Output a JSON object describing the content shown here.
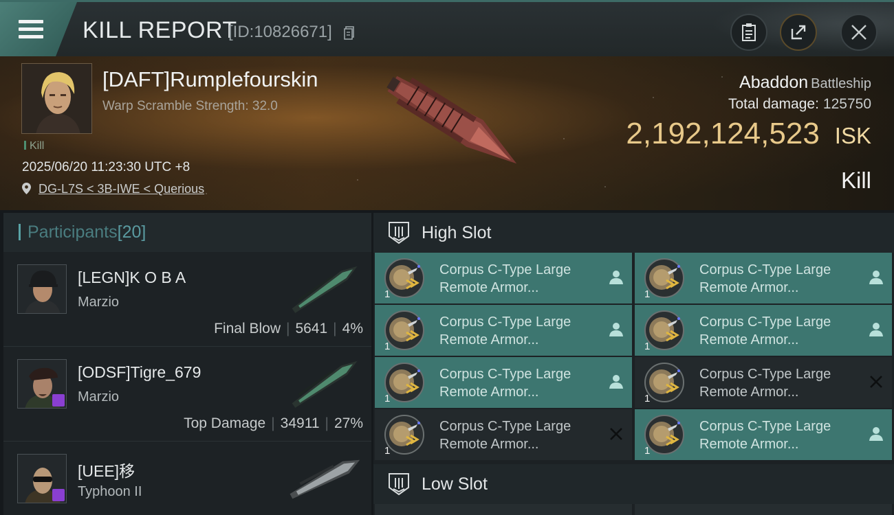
{
  "header": {
    "title": "KILL REPORT",
    "report_id": "[ID:10826671]"
  },
  "victim": {
    "name": "[DAFT]Rumplefourskin",
    "warp_scramble": "Warp Scramble Strength: 32.0",
    "tag": "Kill",
    "datetime": "2025/06/20 11:23:30 UTC +8",
    "location": "DG-L7S < 3B-IWE < Querious",
    "ship_name": "Abaddon",
    "ship_class": "Battleship",
    "total_damage_label": "Total damage:",
    "total_damage": "125750",
    "isk_value": "2,192,124,523",
    "isk_unit": "ISK",
    "result": "Kill"
  },
  "participants": {
    "title": "Participants",
    "count": "[20]",
    "rows": [
      {
        "name": "[LEGN]K O B A",
        "ship": "Marzio",
        "role": "Final Blow",
        "damage": "5641",
        "percent": "4%"
      },
      {
        "name": "[ODSF]Tigre_679",
        "ship": "Marzio",
        "role": "Top Damage",
        "damage": "34911",
        "percent": "27%"
      },
      {
        "name": "[UEE]移",
        "ship": "Typhoon II",
        "role": "",
        "damage": "",
        "percent": ""
      }
    ]
  },
  "slots": {
    "high_label": "High Slot",
    "low_label": "Low Slot",
    "modules": [
      {
        "line1": "Corpus C-Type Large",
        "line2": "Remote Armor...",
        "qty": "1",
        "status": "fitted"
      },
      {
        "line1": "Corpus C-Type Large",
        "line2": "Remote Armor...",
        "qty": "1",
        "status": "fitted"
      },
      {
        "line1": "Corpus C-Type Large",
        "line2": "Remote Armor...",
        "qty": "1",
        "status": "fitted"
      },
      {
        "line1": "Corpus C-Type Large",
        "line2": "Remote Armor...",
        "qty": "1",
        "status": "fitted"
      },
      {
        "line1": "Corpus C-Type Large",
        "line2": "Remote Armor...",
        "qty": "1",
        "status": "fitted"
      },
      {
        "line1": "Corpus C-Type Large",
        "line2": "Remote Armor...",
        "qty": "1",
        "status": "destroyed"
      },
      {
        "line1": "Corpus C-Type Large",
        "line2": "Remote Armor...",
        "qty": "1",
        "status": "destroyed"
      },
      {
        "line1": "Corpus C-Type Large",
        "line2": "Remote Armor...",
        "qty": "1",
        "status": "fitted"
      }
    ]
  },
  "colors": {
    "accent_teal": "#3d7670",
    "isk_gold": "#e8c98a",
    "badge_purple": "#8a3fd1"
  }
}
